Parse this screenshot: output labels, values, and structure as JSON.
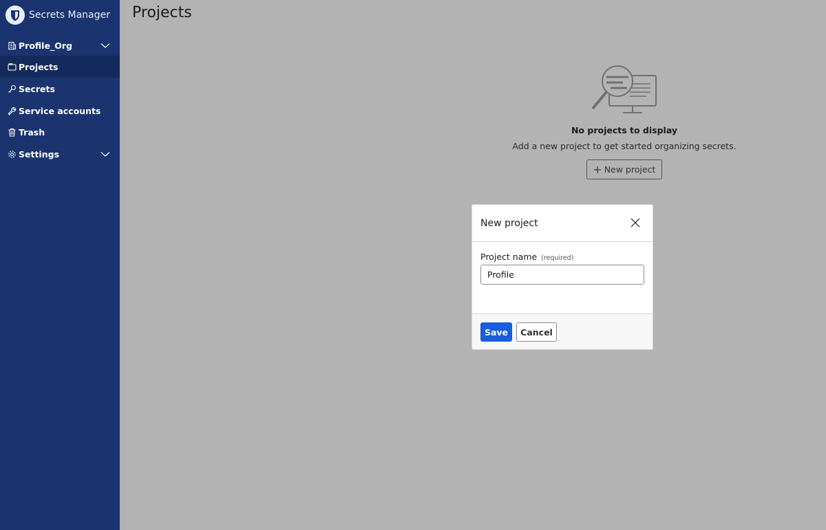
{
  "brand": {
    "name": "Secrets Manager",
    "logo_icon": "bitwarden-shield-icon"
  },
  "sidebar": {
    "items": [
      {
        "label": "Profile_Org",
        "icon": "building-icon",
        "has_chevron": true
      },
      {
        "label": "Projects",
        "icon": "folder-icon",
        "active": true
      },
      {
        "label": "Secrets",
        "icon": "key-icon"
      },
      {
        "label": "Service accounts",
        "icon": "wrench-icon"
      },
      {
        "label": "Trash",
        "icon": "trash-icon"
      },
      {
        "label": "Settings",
        "icon": "gear-icon",
        "has_chevron": true
      }
    ]
  },
  "page": {
    "title": "Projects"
  },
  "empty_state": {
    "title": "No projects to display",
    "subtitle": "Add a new project to get started organizing secrets.",
    "button_label": "New project"
  },
  "dialog": {
    "title": "New project",
    "field_label": "Project name",
    "field_required": "(required)",
    "field_value": "Profile",
    "save_label": "Save",
    "cancel_label": "Cancel"
  },
  "colors": {
    "sidebar_bg": "#1b3470",
    "sidebar_active": "#142a5c",
    "primary": "#175ddc",
    "overlay_bg": "#b3b3b3"
  }
}
